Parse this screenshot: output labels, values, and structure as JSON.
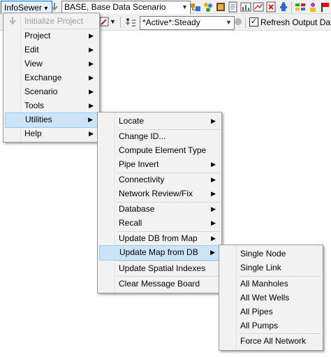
{
  "toolbar": {
    "app_button": "InfoSewer",
    "app_button_arrow": "▾",
    "scenario_combo": "BASE, Base Data Scenario",
    "run_combo": "*Active*:Steady",
    "refresh_label": "Refresh Output Data",
    "refresh_checked": true,
    "tool_icons": [
      "scenario-manager-icon",
      "query-icon",
      "domain-icon",
      "report-icon",
      "graph-icon",
      "map-icon",
      "output-icon",
      "hydrant-icon",
      "palette-icon",
      "node-color-icon"
    ]
  },
  "main_menu": {
    "items": [
      {
        "label": "Initialize Project",
        "disabled": true
      },
      {
        "label": "Project",
        "submenu": true
      },
      {
        "label": "Edit",
        "submenu": true
      },
      {
        "label": "View",
        "submenu": true
      },
      {
        "label": "Exchange",
        "submenu": true
      },
      {
        "label": "Scenario",
        "submenu": true
      },
      {
        "label": "Tools",
        "submenu": true
      },
      {
        "label": "Utilities",
        "submenu": true,
        "highlighted": true
      },
      {
        "label": "Help",
        "submenu": true
      }
    ]
  },
  "utilities_menu": {
    "items": [
      {
        "label": "Locate",
        "submenu": true
      },
      {
        "label": "Change ID..."
      },
      {
        "label": "Compute Element Type"
      },
      {
        "label": "Pipe Invert",
        "submenu": true
      },
      {
        "label": "Connectivity",
        "submenu": true
      },
      {
        "label": "Network Review/Fix",
        "submenu": true
      },
      {
        "label": "Database",
        "submenu": true
      },
      {
        "label": "Recall",
        "submenu": true
      },
      {
        "label": "Update DB from Map",
        "submenu": true
      },
      {
        "label": "Update Map from DB",
        "submenu": true,
        "highlighted": true
      },
      {
        "label": "Update Spatial Indexes"
      },
      {
        "label": "Clear Message Board"
      }
    ]
  },
  "update_map_menu": {
    "items": [
      {
        "label": "Single Node"
      },
      {
        "label": "Single Link"
      },
      {
        "label": "All Manholes"
      },
      {
        "label": "All Wet Wells"
      },
      {
        "label": "All Pipes"
      },
      {
        "label": "All Pumps"
      },
      {
        "label": "Force All Network"
      }
    ]
  },
  "arrow_glyph": "▶",
  "check_glyph": "✓",
  "colors": {
    "highlight_bg": "#cce4f7",
    "highlight_border": "#99c9ef",
    "menu_bg": "#f2f2f2",
    "disabled_text": "#9d9d9d"
  }
}
